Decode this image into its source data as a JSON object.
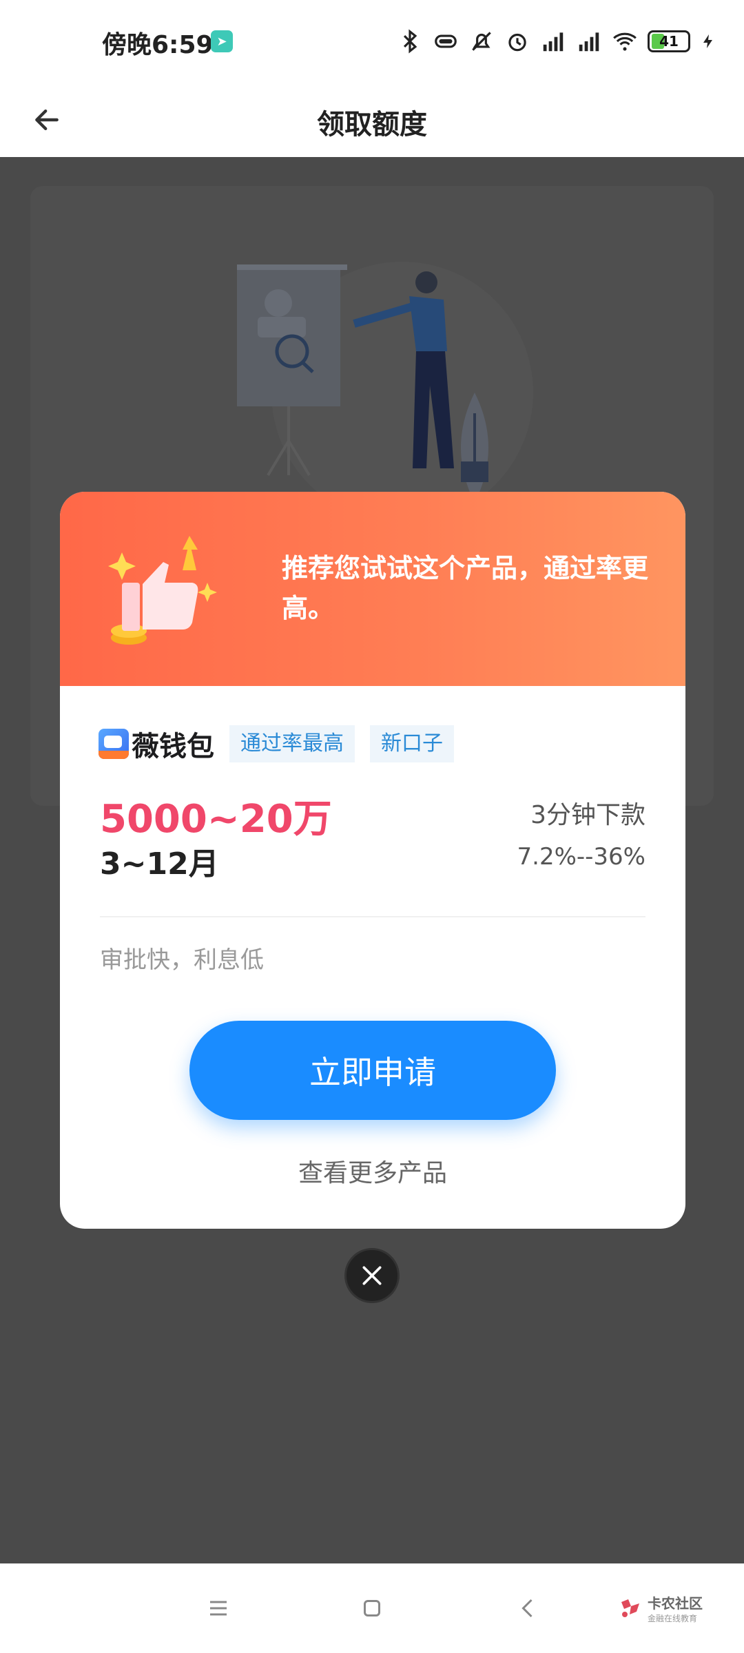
{
  "status_bar": {
    "time": "傍晚6:59",
    "battery": "41",
    "icons": [
      "bluetooth-icon",
      "vibrate-icon",
      "mute-icon",
      "alarm-icon",
      "hd-signal-icon",
      "hd-signal-icon",
      "wifi-icon",
      "battery-icon",
      "charging-icon"
    ]
  },
  "header": {
    "title": "领取额度"
  },
  "modal": {
    "headline": "推荐您试试这个产品，通过率更高。",
    "product": {
      "name": "薇钱包",
      "tags": [
        "通过率最高",
        "新口子"
      ],
      "amount": "5000~20万",
      "period": "3~12月",
      "speed": "3分钟下款",
      "rate": "7.2%--36%",
      "description": "审批快，利息低"
    },
    "apply_label": "立即申请",
    "more_label": "查看更多产品"
  },
  "watermark": {
    "title": "卡农社区",
    "subtitle": "金融在线教育"
  },
  "colors": {
    "accent_blue": "#1a8cff",
    "amount_red": "#f0476a",
    "header_orange": "#ff6848",
    "tag_text": "#2a8ad6"
  }
}
